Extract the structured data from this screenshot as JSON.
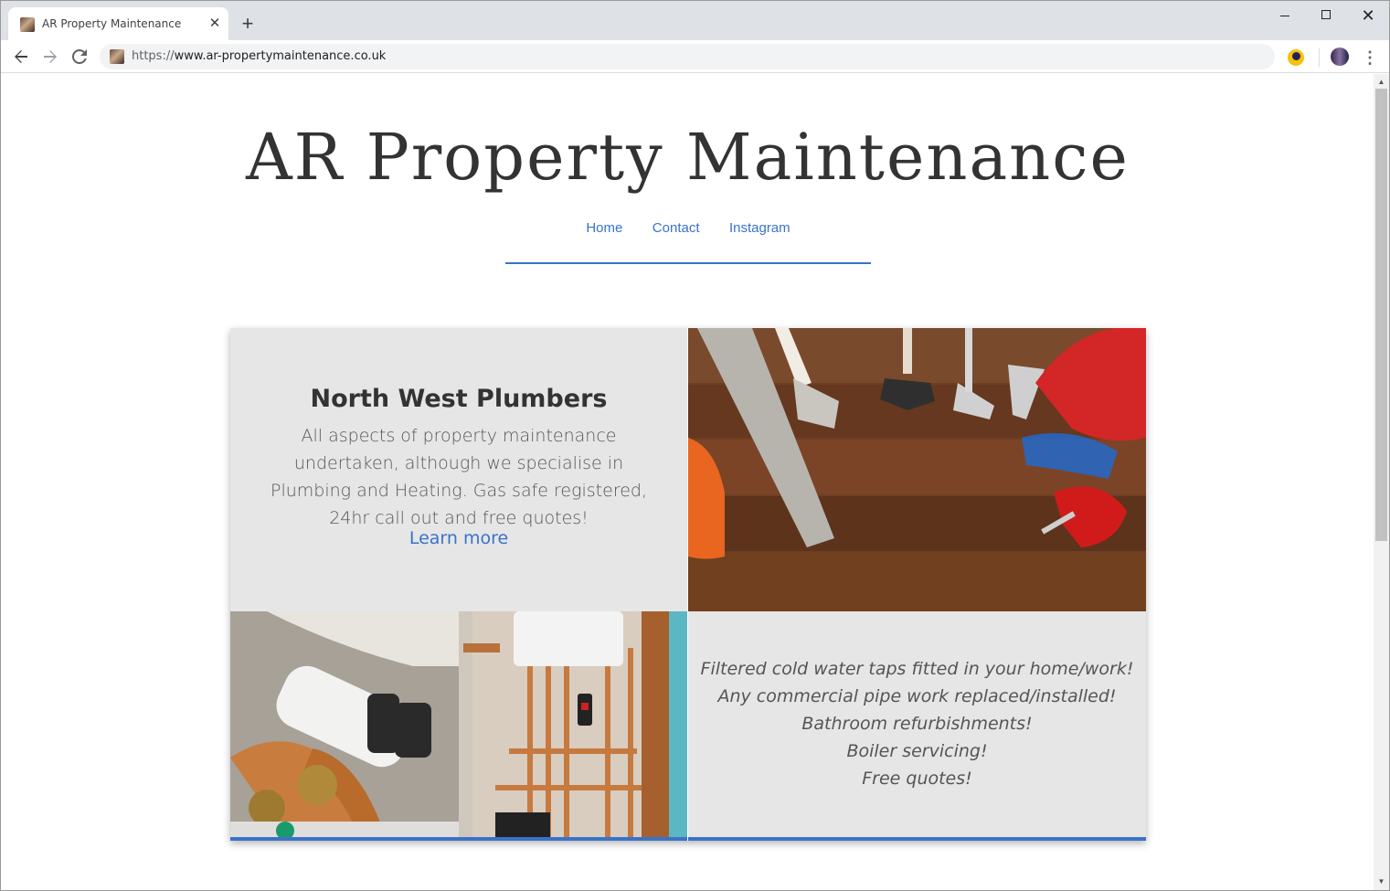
{
  "browser": {
    "tab_title": "AR Property Maintenance",
    "tab_close": "✕",
    "new_tab": "+",
    "url_scheme": "https://",
    "url_host": "www.ar-propertymaintenance.co.uk",
    "icons": {
      "back": "arrow-left-icon",
      "forward": "arrow-right-icon",
      "reload": "reload-icon",
      "menu": "kebab-menu-icon"
    }
  },
  "site": {
    "title": "AR Property Maintenance",
    "nav": [
      "Home",
      "Contact",
      "Instagram"
    ],
    "accent_color": "#3a72c9"
  },
  "intro": {
    "heading": "North West Plumbers",
    "body": "All aspects of property maintenance undertaken, although we specialise in Plumbing and Heating. Gas safe registered, 24hr call out and free quotes!",
    "link": "Learn more"
  },
  "services": [
    "Filtered cold water taps fitted in your home/work!",
    "Any commercial pipe work replaced/installed!",
    "Bathroom refurbishments!",
    "Boiler servicing!",
    "Free quotes!"
  ]
}
